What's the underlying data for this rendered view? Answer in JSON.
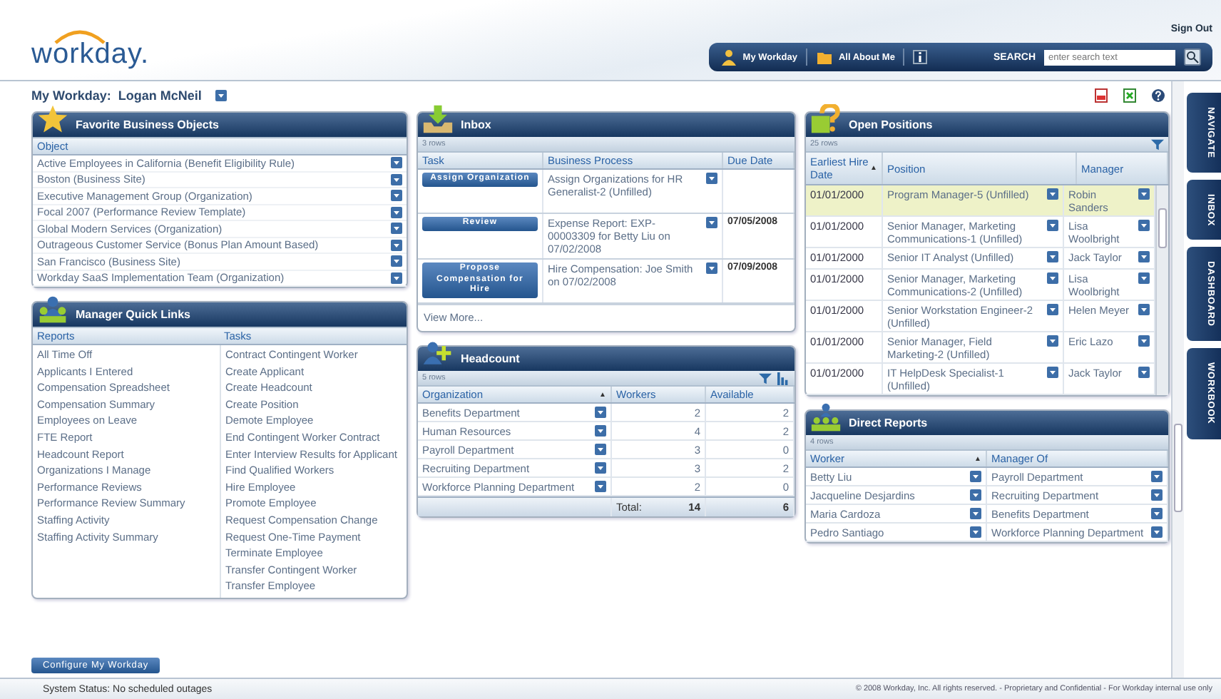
{
  "header": {
    "sign_out": "Sign Out",
    "logo": "workday.",
    "nav": [
      {
        "label": "My Workday",
        "kind": "home"
      },
      {
        "label": "All About Me",
        "kind": "profile"
      }
    ],
    "search": {
      "label": "SEARCH",
      "placeholder": "enter search text"
    }
  },
  "page_title": {
    "label": "My Workday:",
    "name": "Logan McNeil"
  },
  "favorites": {
    "title": "Favorite Business Objects",
    "column": "Object",
    "items": [
      "Active Employees in California (Benefit Eligibility Rule)",
      "Boston (Business Site)",
      "Executive Management Group (Organization)",
      "Focal 2007 (Performance Review Template)",
      "Global Modern Services (Organization)",
      "Outrageous Customer Service (Bonus Plan Amount Based)",
      "San Francisco (Business Site)",
      "Workday SaaS Implementation Team (Organization)"
    ]
  },
  "quick_links": {
    "title": "Manager Quick Links",
    "columns": [
      "Reports",
      "Tasks"
    ],
    "reports": [
      "All Time Off",
      "Applicants I Entered",
      "Compensation Spreadsheet",
      "Compensation Summary",
      "Employees on Leave",
      "FTE Report",
      "Headcount Report",
      "Organizations I Manage",
      "Performance Reviews",
      "Performance Review Summary",
      "Staffing Activity",
      "Staffing Activity Summary"
    ],
    "tasks": [
      "Contract Contingent Worker",
      "Create Applicant",
      "Create Headcount",
      "Create Position",
      "Demote Employee",
      "End Contingent Worker Contract",
      "Enter Interview Results for Applicant",
      "Find Qualified Workers",
      "Hire Employee",
      "Promote Employee",
      "Request Compensation Change",
      "Request One-Time Payment",
      "Terminate Employee",
      "Transfer Contingent Worker",
      "Transfer Employee"
    ]
  },
  "configure_button": "Configure My Workday",
  "inbox": {
    "title": "Inbox",
    "row_count": "3 rows",
    "columns": [
      "Task",
      "Business Process",
      "Due Date"
    ],
    "rows": [
      {
        "task": "Assign Organization",
        "process": "Assign Organizations for HR Generalist-2 (Unfilled)"
      },
      {
        "task": "Review",
        "process": "Expense Report: EXP-00003309 for Betty Liu on 07/02/2008",
        "due": "07/05/2008"
      },
      {
        "task": "Propose Compensation for Hire",
        "process": "Hire Compensation: Joe Smith on 07/02/2008",
        "due": "07/09/2008"
      }
    ],
    "view_more": "View More..."
  },
  "headcount": {
    "title": "Headcount",
    "row_count": "5 rows",
    "columns": [
      {
        "label": "Organization",
        "sort": "▲"
      },
      {
        "label": "Workers"
      },
      {
        "label": "Available"
      }
    ],
    "rows": [
      {
        "org": "Benefits Department",
        "workers": "2",
        "available": "2"
      },
      {
        "org": "Human Resources",
        "workers": "4",
        "available": "2"
      },
      {
        "org": "Payroll Department",
        "workers": "3",
        "available": "0"
      },
      {
        "org": "Recruiting Department",
        "workers": "3",
        "available": "2"
      },
      {
        "org": "Workforce Planning Department",
        "workers": "2",
        "available": "0"
      }
    ],
    "total": {
      "label": "Total:",
      "workers": "14",
      "available": "6"
    }
  },
  "open_positions": {
    "title": "Open Positions",
    "row_count": "25 rows",
    "columns": [
      {
        "label": "Earliest Hire Date",
        "sort": "▲"
      },
      {
        "label": "Position"
      },
      {
        "label": "Manager"
      }
    ],
    "rows": [
      {
        "date": "01/01/2000",
        "position": "Program Manager-5 (Unfilled)",
        "manager": "Robin Sanders",
        "selected": true
      },
      {
        "date": "01/01/2000",
        "position": "Senior Manager, Marketing Communications-1 (Unfilled)",
        "manager": "Lisa Woolbright",
        "selected": false
      },
      {
        "date": "01/01/2000",
        "position": "Senior IT Analyst (Unfilled)",
        "manager": "Jack Taylor",
        "selected": false
      },
      {
        "date": "01/01/2000",
        "position": "Senior Manager, Marketing Communications-2 (Unfilled)",
        "manager": "Lisa Woolbright",
        "selected": false
      },
      {
        "date": "01/01/2000",
        "position": "Senior Workstation Engineer-2 (Unfilled)",
        "manager": "Helen Meyer",
        "selected": false
      },
      {
        "date": "01/01/2000",
        "position": "Senior Manager, Field Marketing-2 (Unfilled)",
        "manager": "Eric Lazo",
        "selected": false
      },
      {
        "date": "01/01/2000",
        "position": "IT HelpDesk Specialist-1 (Unfilled)",
        "manager": "Jack Taylor",
        "selected": false
      }
    ]
  },
  "direct_reports": {
    "title": "Direct Reports",
    "row_count": "4 rows",
    "columns": [
      {
        "label": "Worker",
        "sort": "▲"
      },
      {
        "label": "Manager Of"
      }
    ],
    "rows": [
      {
        "worker": "Betty Liu",
        "org": "Payroll Department"
      },
      {
        "worker": "Jacqueline Desjardins",
        "org": "Recruiting Department"
      },
      {
        "worker": "Maria Cardoza",
        "org": "Benefits Department"
      },
      {
        "worker": "Pedro Santiago",
        "org": "Workforce Planning Department"
      }
    ]
  },
  "side_tabs": [
    {
      "label": "NAVIGATE"
    },
    {
      "label": "INBOX"
    },
    {
      "label": "DASHBOARD"
    },
    {
      "label": "WORKBOOK"
    }
  ],
  "status_bar": {
    "status": "System Status: No scheduled outages",
    "copyright": "© 2008 Workday, Inc. All rights reserved. - Proprietary and Confidential - For Workday internal use only"
  }
}
